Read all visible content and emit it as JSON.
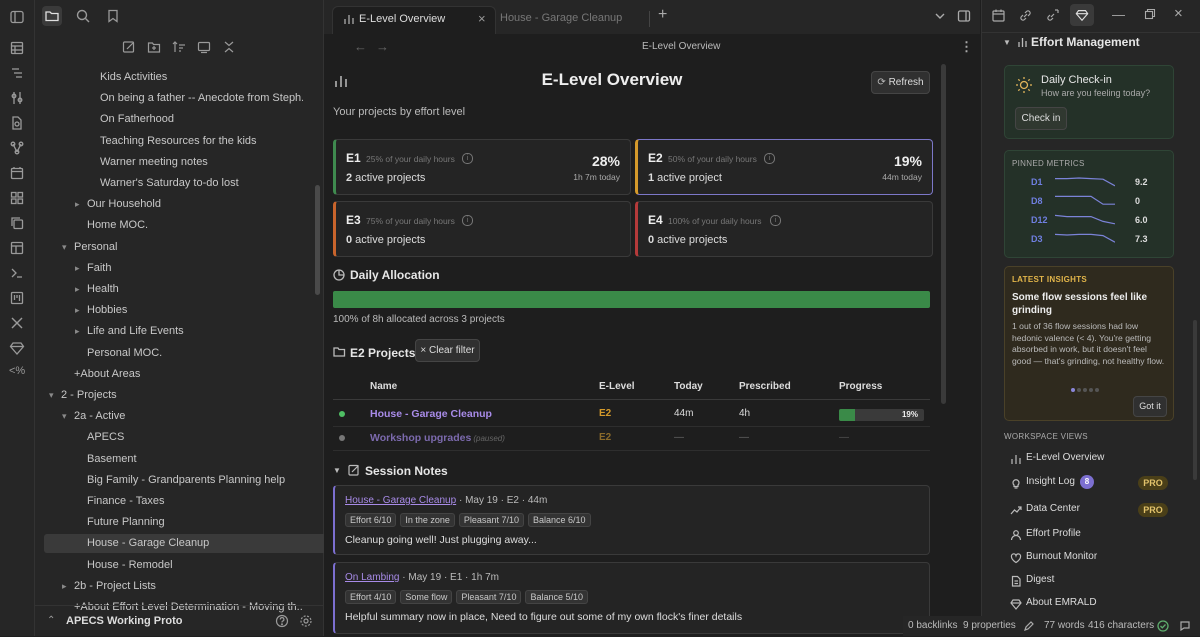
{
  "vault_name": "APECS Working Proto",
  "tree": [
    {
      "label": "Kids Activities",
      "indent": 3,
      "caret": ""
    },
    {
      "label": "On being a father -- Anecdote from Steph...",
      "indent": 3,
      "caret": ""
    },
    {
      "label": "On Fatherhood",
      "indent": 3,
      "caret": ""
    },
    {
      "label": "Teaching Resources for the kids",
      "indent": 3,
      "caret": ""
    },
    {
      "label": "Warner meeting notes",
      "indent": 3,
      "caret": ""
    },
    {
      "label": "Warner's Saturday to-do lost",
      "indent": 3,
      "caret": ""
    },
    {
      "label": "Our Household",
      "indent": 2,
      "caret": "▸"
    },
    {
      "label": "Home MOC.",
      "indent": 2,
      "caret": ""
    },
    {
      "label": "Personal",
      "indent": 1,
      "caret": "▾"
    },
    {
      "label": "Faith",
      "indent": 2,
      "caret": "▸"
    },
    {
      "label": "Health",
      "indent": 2,
      "caret": "▸"
    },
    {
      "label": "Hobbies",
      "indent": 2,
      "caret": "▸"
    },
    {
      "label": "Life and Life Events",
      "indent": 2,
      "caret": "▸"
    },
    {
      "label": "Personal MOC.",
      "indent": 2,
      "caret": ""
    },
    {
      "label": "+About Areas",
      "indent": 1,
      "caret": ""
    },
    {
      "label": "2 - Projects",
      "indent": 0,
      "caret": "▾"
    },
    {
      "label": "2a - Active",
      "indent": 1,
      "caret": "▾"
    },
    {
      "label": "APECS",
      "indent": 2,
      "caret": ""
    },
    {
      "label": "Basement",
      "indent": 2,
      "caret": ""
    },
    {
      "label": "Big Family - Grandparents Planning help",
      "indent": 2,
      "caret": ""
    },
    {
      "label": "Finance - Taxes",
      "indent": 2,
      "caret": ""
    },
    {
      "label": "Future Planning",
      "indent": 2,
      "caret": ""
    },
    {
      "label": "House - Garage Cleanup",
      "indent": 2,
      "caret": "",
      "selected": true
    },
    {
      "label": "House - Remodel",
      "indent": 2,
      "caret": ""
    },
    {
      "label": "2b - Project Lists",
      "indent": 1,
      "caret": "▸"
    },
    {
      "label": "+About Effort Level Determination - Moving th...",
      "indent": 1,
      "caret": ""
    }
  ],
  "tabs": {
    "active": "E-Level Overview",
    "inactive": "House - Garage Cleanup",
    "close": "×",
    "new": "+"
  },
  "view_title": "E-Level Overview",
  "page": {
    "title": "E-Level Overview",
    "subtitle": "Your projects by effort level",
    "refresh_label": "Refresh"
  },
  "levels": [
    {
      "code": "E1",
      "desc": "25% of your daily hours",
      "count": "2",
      "count_label": "active projects",
      "pct": "28%",
      "time": "1h 7m today",
      "color": "#3f8a4f",
      "highlight": false
    },
    {
      "code": "E2",
      "desc": "50% of your daily hours",
      "count": "1",
      "count_label": "active project",
      "pct": "19%",
      "time": "44m today",
      "color": "#d59a2b",
      "highlight": true
    },
    {
      "code": "E3",
      "desc": "75% of your daily hours",
      "count": "0",
      "count_label": "active projects",
      "pct": "",
      "time": "",
      "color": "#c8642c",
      "highlight": false
    },
    {
      "code": "E4",
      "desc": "100% of your daily hours",
      "count": "0",
      "count_label": "active projects",
      "pct": "",
      "time": "",
      "color": "#b53a3a",
      "highlight": false
    }
  ],
  "allocation": {
    "heading": "Daily Allocation",
    "fraction": 1.0,
    "caption": "100% of 8h allocated across 3 projects"
  },
  "projects": {
    "heading": "E2 Projects",
    "clear_filter": "Clear filter",
    "columns": [
      "Name",
      "E-Level",
      "Today",
      "Prescribed",
      "Progress"
    ],
    "rows": [
      {
        "name": "House - Garage Cleanup",
        "paused": "",
        "level": "E2",
        "today": "44m",
        "prescribed": "4h",
        "progress_label": "19%",
        "progress": 0.19,
        "active": true
      },
      {
        "name": "Workshop upgrades",
        "paused": "(paused)",
        "level": "E2",
        "today": "—",
        "prescribed": "—",
        "progress_label": "—",
        "progress": 0,
        "active": false
      }
    ]
  },
  "session_notes": {
    "heading": "Session Notes",
    "notes": [
      {
        "link": "House - Garage Cleanup",
        "meta": " · May 19 · E2 · 44m",
        "tags": [
          "Effort 6/10",
          "In the zone",
          "Pleasant 7/10",
          "Balance 6/10"
        ],
        "text": "Cleanup going well! Just plugging away..."
      },
      {
        "link": "On Lambing",
        "meta": " · May 19 · E1 · 1h 7m",
        "tags": [
          "Effort 4/10",
          "Some flow",
          "Pleasant 7/10",
          "Balance 5/10"
        ],
        "text": "Helpful summary now in place, Need to figure out some of my own flock's finer details"
      }
    ]
  },
  "right": {
    "heading": "Effort Management",
    "checkin": {
      "title": "Daily Check-in",
      "subtitle": "How are you feeling today?",
      "button": "Check in"
    },
    "metrics": {
      "heading": "PINNED METRICS",
      "items": [
        {
          "label": "D1",
          "value": "9.2",
          "trend": [
            0.3,
            0.3,
            0.25,
            0.3,
            0.35,
            0.9
          ]
        },
        {
          "label": "D8",
          "value": "0",
          "trend": [
            0.2,
            0.2,
            0.2,
            0.2,
            0.85,
            0.85
          ]
        },
        {
          "label": "D12",
          "value": "6.0",
          "trend": [
            0.2,
            0.3,
            0.3,
            0.3,
            0.7,
            0.9
          ]
        },
        {
          "label": "D3",
          "value": "7.3",
          "trend": [
            0.2,
            0.25,
            0.2,
            0.2,
            0.3,
            0.85
          ]
        }
      ]
    },
    "insights": {
      "label": "LATEST INSIGHTS",
      "title": "Some flow sessions feel like grinding",
      "body": "1 out of 36 flow sessions had low hedonic valence (< 4). You're getting absorbed in work, but it doesn't feel good — that's grinding, not healthy flow.",
      "button": "Got it"
    },
    "views_heading": "WORKSPACE VIEWS",
    "views": [
      {
        "label": "E-Level Overview",
        "icon": "bar-chart-icon",
        "badge": "",
        "pro": ""
      },
      {
        "label": "Insight Log",
        "icon": "lightbulb-icon",
        "badge": "8",
        "pro": "PRO"
      },
      {
        "label": "Data Center",
        "icon": "trend-icon",
        "badge": "",
        "pro": "PRO"
      },
      {
        "label": "Effort Profile",
        "icon": "user-icon",
        "badge": "",
        "pro": ""
      },
      {
        "label": "Burnout Monitor",
        "icon": "heart-pulse-icon",
        "badge": "",
        "pro": ""
      },
      {
        "label": "Digest",
        "icon": "document-icon",
        "badge": "",
        "pro": ""
      },
      {
        "label": "About EMRALD",
        "icon": "gem-icon",
        "badge": "",
        "pro": ""
      }
    ]
  },
  "status": {
    "backlinks": "0 backlinks",
    "properties": "9 properties",
    "words": "77 words",
    "chars": "416 characters"
  }
}
